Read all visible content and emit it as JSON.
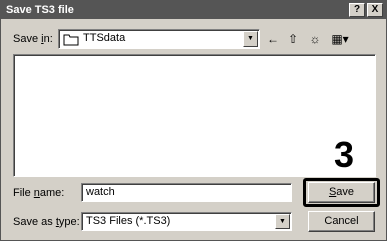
{
  "window": {
    "title": "Save TS3 file",
    "help_label": "?",
    "close_label": "X"
  },
  "save_in": {
    "label_pre": "Save ",
    "label_key": "i",
    "label_post": "n:",
    "value": "TTSdata"
  },
  "toolbar": {
    "back_glyph": "←",
    "up_glyph": "⇧",
    "newfolder_glyph": "☼",
    "view_glyph": "▦▾"
  },
  "file_name": {
    "label_pre": "File ",
    "label_key": "n",
    "label_post": "ame:",
    "value": "watch"
  },
  "save_as_type": {
    "label_pre": "Save as ",
    "label_key": "t",
    "label_post": "ype:",
    "value": "TS3 Files (*.TS3)"
  },
  "buttons": {
    "save_key": "S",
    "save_rest": "ave",
    "cancel": "Cancel"
  },
  "callout": "3"
}
